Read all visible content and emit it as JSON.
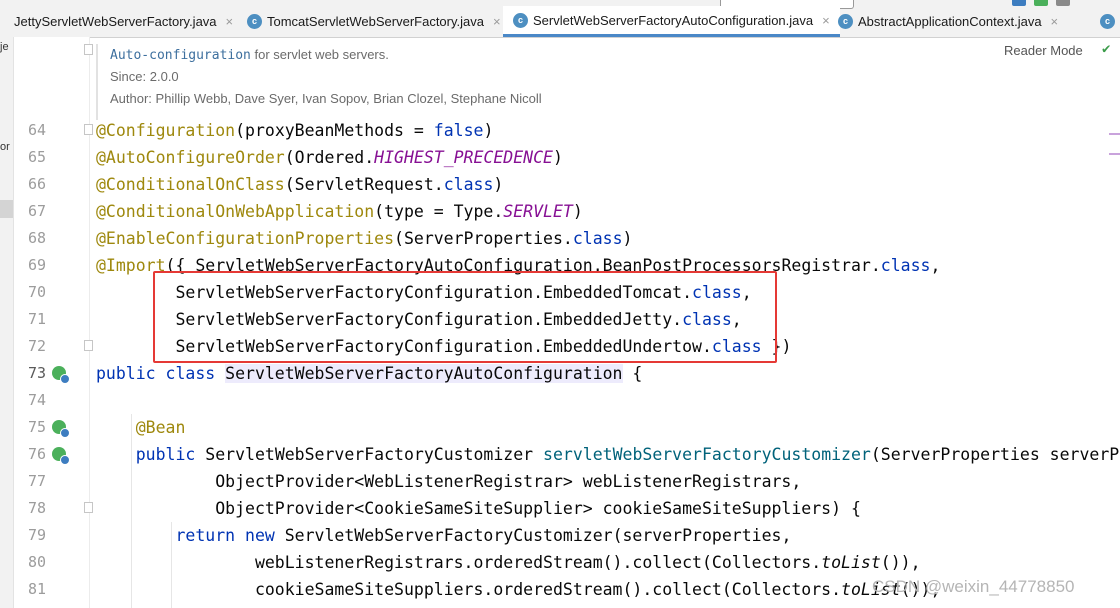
{
  "tabs": [
    {
      "label": "JettyServletWebServerFactory.java",
      "icon": "class-icon",
      "active": false
    },
    {
      "label": "TomcatServletWebServerFactory.java",
      "icon": "class-icon",
      "active": false
    },
    {
      "label": "ServletWebServerFactoryAutoConfiguration.java",
      "icon": "class-icon",
      "active": true
    },
    {
      "label": "AbstractApplicationContext.java",
      "icon": "class-icon",
      "active": false
    }
  ],
  "tab_close_glyph": "×",
  "tab_class_glyph": "c",
  "left_strip": {
    "labels": [
      "je",
      "or"
    ]
  },
  "doc": {
    "link": "Auto-configuration",
    "text": " for servlet web servers.",
    "since": "Since:   2.0.0",
    "author": "Author: Phillip Webb, Dave Syer, Ivan Sopov, Brian Clozel, Stephane Nicoll"
  },
  "reader_mode": "Reader Mode",
  "watermark": "CSDN @weixin_44778850",
  "colors": {
    "accent": "#4a88c7",
    "highlight_box": "#e53935",
    "annotation": "#9e880d",
    "keyword": "#0033b3"
  },
  "line_numbers": [
    "64",
    "65",
    "66",
    "67",
    "68",
    "69",
    "70",
    "71",
    "72",
    "73",
    "74",
    "75",
    "76",
    "77",
    "78",
    "79",
    "80",
    "81"
  ],
  "code": {
    "l64": {
      "a": "@Configuration",
      "b": "(proxyBeanMethods = ",
      "c": "false",
      "d": ")"
    },
    "l65": {
      "a": "@AutoConfigureOrder",
      "b": "(Ordered.",
      "c": "HIGHEST_PRECEDENCE",
      "d": ")"
    },
    "l66": {
      "a": "@ConditionalOnClass",
      "b": "(ServletRequest.",
      "c": "class",
      "d": ")"
    },
    "l67": {
      "a": "@ConditionalOnWebApplication",
      "b": "(type = Type.",
      "c": "SERVLET",
      "d": ")"
    },
    "l68": {
      "a": "@EnableConfigurationProperties",
      "b": "(ServerProperties.",
      "c": "class",
      "d": ")"
    },
    "l69": {
      "a": "@Import",
      "b": "({ ServletWebServerFactoryAutoConfiguration.BeanPostProcessorsRegistrar.",
      "c": "class",
      "d": ","
    },
    "l70": {
      "b": "        ServletWebServerFactoryConfiguration.EmbeddedTomcat.",
      "c": "class",
      "d": ","
    },
    "l71": {
      "b": "        ServletWebServerFactoryConfiguration.EmbeddedJetty.",
      "c": "class",
      "d": ","
    },
    "l72": {
      "b": "        ServletWebServerFactoryConfiguration.EmbeddedUndertow.",
      "c": "class",
      "d": " })"
    },
    "l73": {
      "a": "public class ",
      "b": "ServletWebServerFactoryAutoConfiguration",
      "d": " {"
    },
    "l75": {
      "a": "    @Bean"
    },
    "l76": {
      "a": "    public ",
      "b": "ServletWebServerFactoryCustomizer ",
      "c": "servletWebServerFactoryCustomizer",
      "d": "(ServerProperties serverP"
    },
    "l77": {
      "b": "            ObjectProvider<WebListenerRegistrar> webListenerRegistrars,"
    },
    "l78": {
      "b": "            ObjectProvider<CookieSameSiteSupplier> cookieSameSiteSuppliers) {"
    },
    "l79": {
      "a": "        return new ",
      "b": "ServletWebServerFactoryCustomizer(serverProperties,"
    },
    "l80": {
      "b": "                webListenerRegistrars.orderedStream().collect(Collectors.",
      "c": "toList",
      "d": "()),"
    },
    "l81": {
      "b": "                cookieSameSiteSuppliers.orderedStream().collect(Collectors.",
      "c": "toList",
      "d": "()),"
    }
  }
}
